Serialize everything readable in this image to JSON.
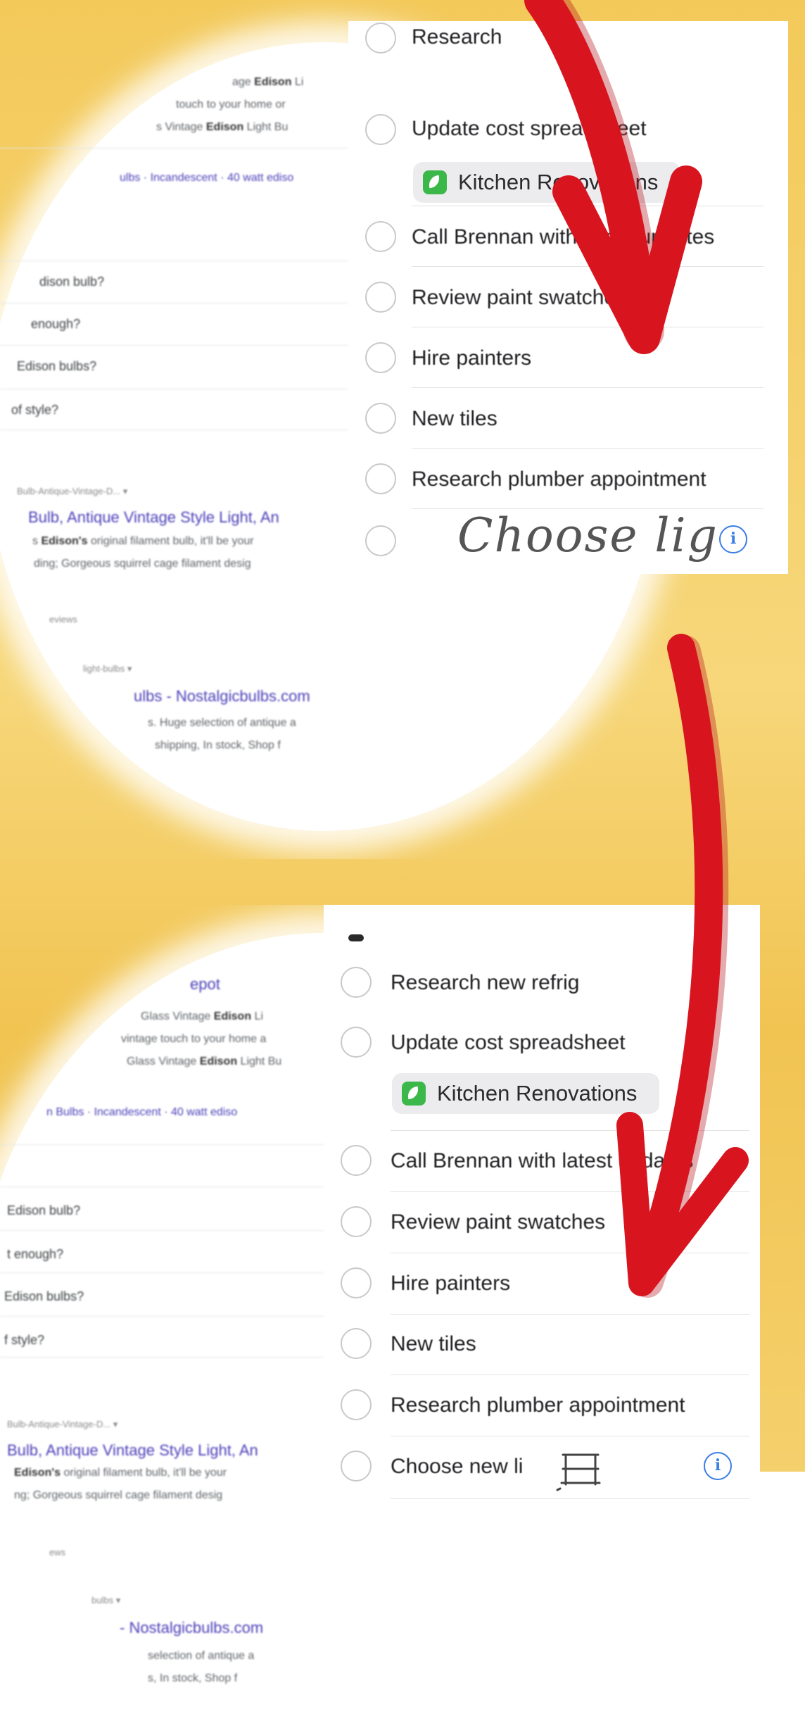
{
  "colors": {
    "accent_red": "#d8141f",
    "chip_green": "#3cb84a",
    "info_blue": "#3a7ee6",
    "background_yellow": "#f4cd5a",
    "link_purple": "#4b3fb8"
  },
  "top": {
    "search": {
      "lines": [
        {
          "pre": "age ",
          "bold": "Edison",
          "post": " Li"
        },
        {
          "pre": "touch to your home or",
          "bold": "",
          "post": ""
        },
        {
          "pre": "s Vintage ",
          "bold": "Edison",
          "post": " Light Bu"
        },
        {
          "chip": "ulbs · Incandescent · 40 watt ediso"
        },
        {
          "q": "dison bulb?"
        },
        {
          "q": "enough?"
        },
        {
          "q": "Edison bulbs?"
        },
        {
          "q": "of style?"
        },
        {
          "url": "Bulb-Antique-Vintage-D... ▾"
        },
        {
          "title": "Bulb, Antique Vintage Style Light, An"
        },
        {
          "pre": "s ",
          "bold": "Edison's",
          "post": " original filament bulb, it'll be your"
        },
        {
          "pre": "ding; Gorgeous squirrel cage filament desig",
          "bold": "",
          "post": ""
        },
        {
          "url": "eviews"
        },
        {
          "url": "light-bulbs ▾"
        },
        {
          "title": "ulbs - Nostalgicbulbs.com"
        },
        {
          "pre": "s. Huge selection of antique a",
          "bold": "",
          "post": ""
        },
        {
          "pre": "shipping, In stock, Shop f",
          "bold": "",
          "post": ""
        }
      ]
    },
    "reminders": {
      "items": [
        {
          "label": "Research",
          "clipped": true
        },
        {
          "label": "Update cost spreadsheet"
        },
        {
          "label": "Call Brennan with latest updates"
        },
        {
          "label": "Review paint swatches"
        },
        {
          "label": "Hire painters"
        },
        {
          "label": "New tiles"
        },
        {
          "label": "Research plumber appointment"
        }
      ],
      "list_chip": "Kitchen Renovations",
      "handwriting": "Choose lig",
      "info_icon": "info-icon"
    }
  },
  "bottom": {
    "search": {
      "lines": [
        {
          "title": "epot"
        },
        {
          "pre": "Glass Vintage ",
          "bold": "Edison",
          "post": " Li"
        },
        {
          "pre": "vintage touch to your home a",
          "bold": "",
          "post": ""
        },
        {
          "pre": "Glass Vintage ",
          "bold": "Edison",
          "post": " Light Bu"
        },
        {
          "chip": "n Bulbs · Incandescent · 40 watt ediso"
        },
        {
          "q": "Edison bulb?"
        },
        {
          "q": "t enough?"
        },
        {
          "q": "Edison bulbs?"
        },
        {
          "q": "f style?"
        },
        {
          "url": "Bulb-Antique-Vintage-D... ▾"
        },
        {
          "title": "Bulb, Antique Vintage Style Light, An"
        },
        {
          "pre": "",
          "bold": "Edison's",
          "post": " original filament bulb, it'll be your"
        },
        {
          "pre": "ng; Gorgeous squirrel cage filament desig",
          "bold": "",
          "post": ""
        },
        {
          "url": "ews"
        },
        {
          "url": "bulbs ▾"
        },
        {
          "title": "- Nostalgicbulbs.com"
        },
        {
          "pre": "selection of antique a",
          "bold": "",
          "post": ""
        },
        {
          "pre": "s, In stock, Shop f",
          "bold": "",
          "post": ""
        }
      ]
    },
    "reminders": {
      "items": [
        {
          "label": "Research new refrig"
        },
        {
          "label": "Update cost spreadsheet"
        },
        {
          "label": "Call Brennan with latest updates"
        },
        {
          "label": "Review paint swatches"
        },
        {
          "label": "Hire painters"
        },
        {
          "label": "New tiles"
        },
        {
          "label": "Research plumber appointment"
        },
        {
          "label": "Choose new li"
        }
      ],
      "list_chip": "Kitchen Renovations",
      "info_icon": "info-icon"
    }
  }
}
